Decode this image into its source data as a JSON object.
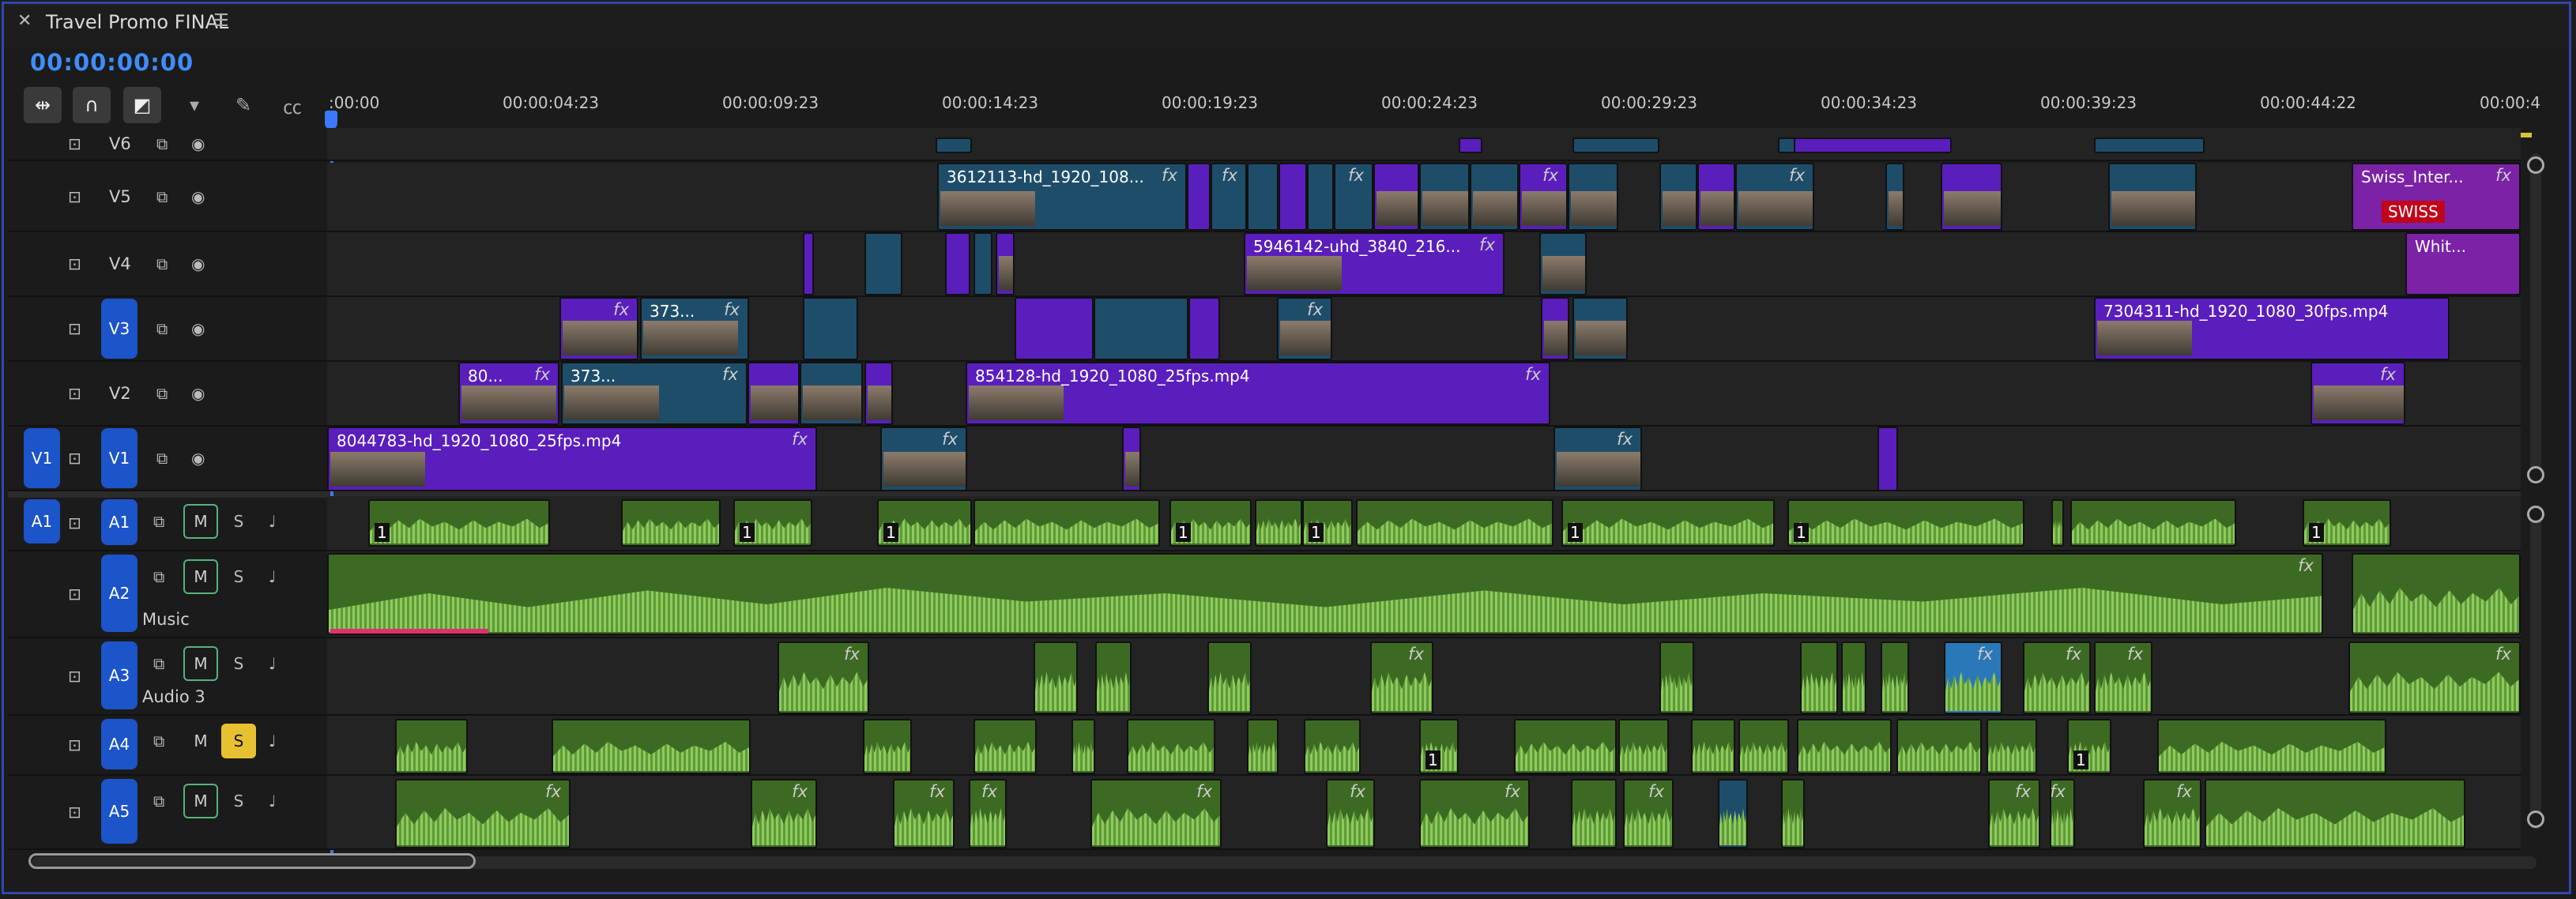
{
  "sequence": {
    "title": "Travel Promo FINAL",
    "timecode": "00:00:00:00"
  },
  "icons": {
    "close": "close-icon",
    "menu": "hamburger-menu-icon",
    "snap": "snap-magnet-icon",
    "insert": "insert-sequence-icon",
    "linked": "linked-selection-icon",
    "marker": "add-marker-icon",
    "wrench": "wrench-settings-icon",
    "captions": "captions-icon"
  },
  "ruler": {
    "labels": [
      ":00:00",
      "00:00:04:23",
      "00:00:09:23",
      "00:00:14:23",
      "00:00:19:23",
      "00:00:24:23",
      "00:00:29:23",
      "00:00:34:23",
      "00:00:39:23",
      "00:00:44:22",
      "00:00:4"
    ]
  },
  "tracks": {
    "video": [
      {
        "name": "V6",
        "target": false
      },
      {
        "name": "V5",
        "target": false
      },
      {
        "name": "V4",
        "target": false
      },
      {
        "name": "V3",
        "target": true
      },
      {
        "name": "V2",
        "target": false
      },
      {
        "name": "V1",
        "target": true,
        "source": "V1"
      }
    ],
    "audio": [
      {
        "name": "A1",
        "source": "A1",
        "mute": "M",
        "solo": "S",
        "label": ""
      },
      {
        "name": "A2",
        "mute": "M",
        "solo": "S",
        "label": "Music"
      },
      {
        "name": "A3",
        "mute": "M",
        "solo": "S",
        "label": "Audio 3"
      },
      {
        "name": "A4",
        "mute": "M",
        "solo": "S",
        "label": ""
      },
      {
        "name": "A5",
        "mute": "M",
        "solo": "S",
        "label": ""
      }
    ]
  },
  "clips": {
    "v5_main": "3612113-hd_1920_108...",
    "v5_swiss": "Swiss_Inter...",
    "v5_swiss_logo": "SWISS",
    "v4_main": "5946142-uhd_3840_216...",
    "v4_white": "Whit...",
    "v3_a": "373...",
    "v3_right": "7304311-hd_1920_1080_30fps.mp4",
    "v2_a": "80...",
    "v2_b": "373...",
    "v2_main": "854128-hd_1920_1080_25fps.mp4",
    "v1_main": "8044783-hd_1920_1080_25fps.mp4",
    "fx": "fx",
    "one": "1"
  },
  "colors": {
    "video_clip": "#5a1ebd",
    "video_clip_alt": "#1e4d6a",
    "audio_clip": "#3d6a23",
    "timecode": "#3f8cff",
    "solo_on": "#e8c132",
    "target": "#1c54c9"
  }
}
